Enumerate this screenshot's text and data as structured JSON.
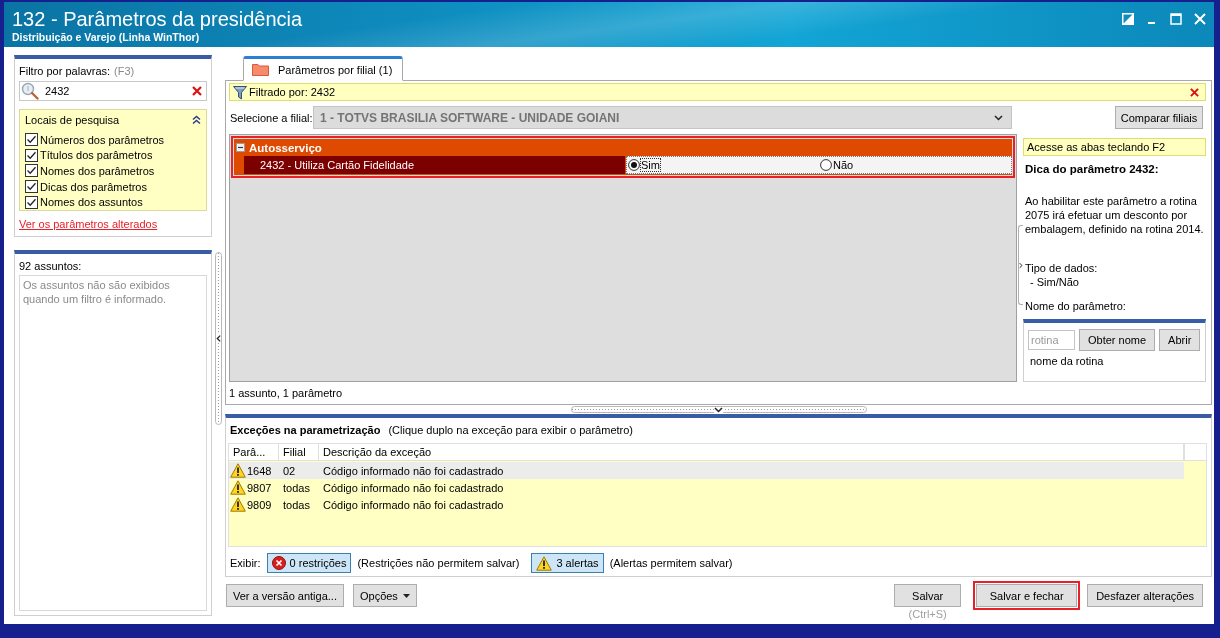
{
  "window": {
    "title": "132 - Parâmetros da presidência",
    "subtitle": "Distribuição e Varejo (Linha WinThor)"
  },
  "filter_panel": {
    "label": "Filtro por palavras:",
    "shortcut": "(F3)",
    "search": {
      "value": "2432"
    },
    "search_locations": {
      "title": "Locais de pesquisa",
      "expanded": true,
      "options": [
        {
          "label": "Números dos parâmetros",
          "checked": true
        },
        {
          "label": "Títulos dos parâmetros",
          "checked": true
        },
        {
          "label": "Nomes dos parâmetros",
          "checked": true
        },
        {
          "label": "Dicas dos parâmetros",
          "checked": true
        },
        {
          "label": "Nomes dos assuntos",
          "checked": true
        }
      ]
    },
    "link": "Ver os parâmetros alterados"
  },
  "subjects_panel": {
    "title": "92 assuntos:",
    "message": "Os assuntos não são exibidos quando um filtro é informado."
  },
  "tabs": [
    {
      "label": "Parâmetros por filial (1)",
      "selected": true
    }
  ],
  "filter_bar": {
    "text": "Filtrado por: 2432"
  },
  "branch": {
    "label": "Selecione a filial:",
    "value": "1 - TOTVS BRASILIA SOFTWARE - UNIDADE GOIANI",
    "disabled": true
  },
  "compare_button": "Comparar filiais",
  "groups": [
    {
      "name": "Autosserviço",
      "expanded": true,
      "highlighted": true,
      "parameters": [
        {
          "label": "2432 - Utiliza Cartão Fidelidade",
          "options": [
            {
              "label": "Sim",
              "selected": true
            },
            {
              "label": "Não",
              "selected": false
            }
          ]
        }
      ]
    }
  ],
  "grid_status": "1 assunto, 1 parâmetro",
  "hint_panel": {
    "note": "Acesse as abas teclando F2",
    "title": "Dica do parâmetro 2432:",
    "description": "Ao habilitar este parâmetro a rotina 2075 irá efetuar um desconto por embalagem, definido na rotina 2014.",
    "data_type_label": "Tipo de dados:",
    "data_type_value": "- Sim/Não",
    "name_label": "Nome do parâmetro:"
  },
  "routine_lookup": {
    "placeholder": "rotina",
    "buttons": [
      "Obter nome",
      "Abrir"
    ],
    "result": "nome da rotina"
  },
  "exceptions": {
    "title": "Exceções na parametrização",
    "hint": "(Clique duplo na exceção para exibir o parâmetro)",
    "columns": [
      "Parâ...",
      "Filial",
      "Descrição da exceção"
    ],
    "rows": [
      {
        "cells": [
          "1648",
          "02",
          "Código informado não foi cadastrado"
        ],
        "selected": true
      },
      {
        "cells": [
          "9807",
          "todas",
          "Código informado não foi cadastrado"
        ],
        "selected": false
      },
      {
        "cells": [
          "9809",
          "todas",
          "Código informado não foi cadastrado"
        ],
        "selected": false
      }
    ],
    "show_label": "Exibir:",
    "toggles": [
      {
        "kind": "error",
        "label": "0 restrições",
        "note": "(Restrições não permitem salvar)",
        "on": true
      },
      {
        "kind": "warning",
        "label": "3 alertas",
        "note": "(Alertas permitem salvar)",
        "on": true
      }
    ]
  },
  "footer": {
    "left_buttons": [
      {
        "label": "Ver a versão antiga...",
        "menu": false
      },
      {
        "label": "Opções",
        "menu": true
      }
    ],
    "right_buttons": [
      {
        "label": "Salvar",
        "shortcut": "(Ctrl+S)",
        "highlighted": false
      },
      {
        "label": "Salvar e fechar",
        "highlighted": true
      },
      {
        "label": "Desfazer alterações",
        "highlighted": false
      }
    ]
  }
}
